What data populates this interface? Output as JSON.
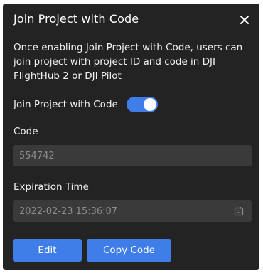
{
  "dialog": {
    "title": "Join Project with Code",
    "description": "Once enabling Join Project with Code, users can join project with project ID and code in DJI FlightHub 2 or DJI Pilot",
    "toggle": {
      "label": "Join Project with Code",
      "enabled": true
    },
    "code": {
      "label": "Code",
      "value": "554742"
    },
    "expiration": {
      "label": "Expiration Time",
      "value": "2022-02-23 15:36:07"
    },
    "buttons": {
      "edit": "Edit",
      "copy_code": "Copy Code"
    }
  },
  "icons": {
    "close": "close-icon",
    "calendar": "calendar-icon"
  },
  "colors": {
    "dialog_bg": "#232323",
    "field_bg": "#3a3a3a",
    "accent": "#3f7ee8",
    "muted_text": "#8d8d8d"
  }
}
